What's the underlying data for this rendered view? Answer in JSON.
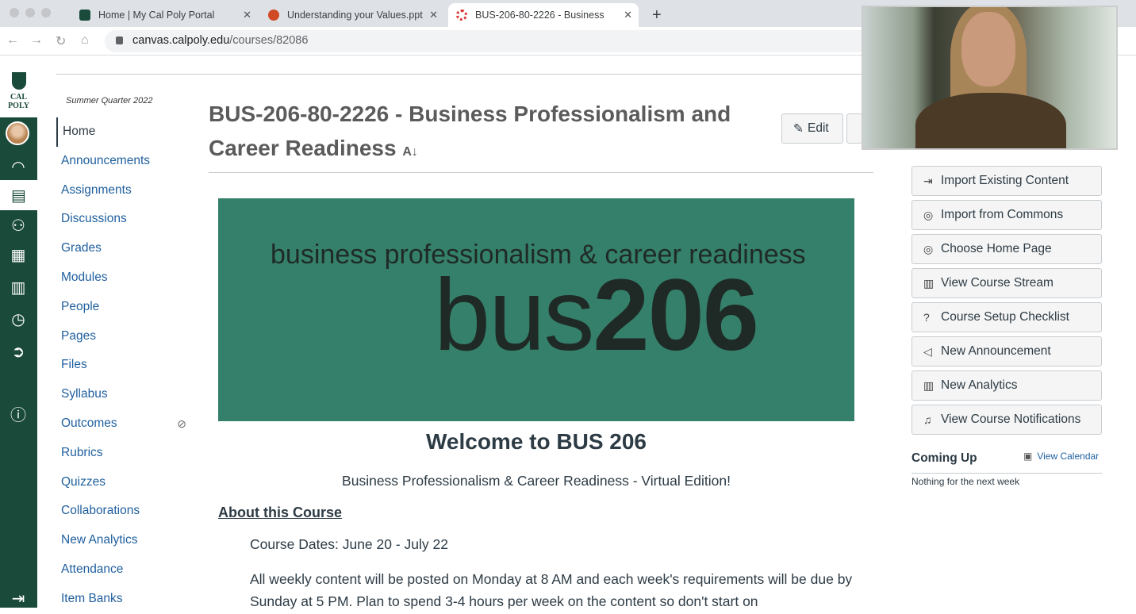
{
  "browser": {
    "tabs": [
      {
        "title": "Home | My Cal Poly Portal",
        "icon": "cal-poly-shield-icon"
      },
      {
        "title": "Understanding your Values.ppt",
        "icon": "powerpoint-icon"
      },
      {
        "title": "BUS-206-80-2226 - Business",
        "icon": "canvas-icon"
      }
    ],
    "url_host": "canvas.calpoly.edu",
    "url_path": "/courses/82086"
  },
  "global_nav": {
    "logo": "CAL POLY",
    "items": [
      "account",
      "dashboard",
      "courses",
      "groups",
      "calendar",
      "inbox",
      "history",
      "logout",
      "help",
      "collapse"
    ]
  },
  "course_nav": {
    "term": "Summer Quarter 2022",
    "items": [
      "Home",
      "Announcements",
      "Assignments",
      "Discussions",
      "Grades",
      "Modules",
      "People",
      "Pages",
      "Files",
      "Syllabus",
      "Outcomes",
      "Rubrics",
      "Quizzes",
      "Collaborations",
      "New Analytics",
      "Attendance",
      "Item Banks"
    ]
  },
  "main": {
    "title": "BUS-206-80-2226 - Business Professionalism and Career Readiness",
    "edit_label": "Edit",
    "banner_sub": "business professionalism & career readiness",
    "banner_bus": "bus",
    "banner_num": "206",
    "welcome": "Welcome to BUS 206",
    "tagline": "Business Professionalism & Career Readiness - Virtual Edition!",
    "about": "About this Course",
    "dates": "Course Dates: June 20 - July 22",
    "para": "All weekly content will be posted on Monday at 8 AM and each week's requirements will be due by Sunday at 5 PM. Plan to spend 3-4 hours per week on the content so don't start on"
  },
  "sidebar": {
    "buttons": [
      "Import Existing Content",
      "Import from Commons",
      "Choose Home Page",
      "View Course Stream",
      "Course Setup Checklist",
      "New Announcement",
      "New Analytics",
      "View Course Notifications"
    ],
    "coming_up": "Coming Up",
    "view_calendar": "View Calendar",
    "nothing": "Nothing for the next week"
  },
  "colors": {
    "nav_green": "#1a4a3a",
    "banner_green": "#35806a",
    "link": "#1f5f9e"
  }
}
